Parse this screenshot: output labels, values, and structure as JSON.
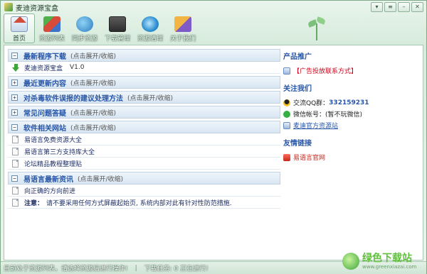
{
  "window": {
    "title": "麦迪资源宝盒"
  },
  "toolbar": {
    "items": [
      {
        "label": "首页",
        "icon": "home-icon"
      },
      {
        "label": "资源列表",
        "icon": "list-icon"
      },
      {
        "label": "同步资源",
        "icon": "sync-icon"
      },
      {
        "label": "下载管理",
        "icon": "download-icon"
      },
      {
        "label": "资源清理",
        "icon": "clean-icon"
      },
      {
        "label": "关于我们",
        "icon": "about-icon"
      }
    ]
  },
  "sections": [
    {
      "toggle": "−",
      "title": "最新程序下载",
      "hint": "(点击展开/收缩)",
      "rows": [
        {
          "text": "麦迪资源宝盒",
          "version": "V1.0"
        }
      ]
    },
    {
      "toggle": "+",
      "title": "最近更新内容",
      "hint": "(点击展开/收缩)"
    },
    {
      "toggle": "+",
      "title": "对杀毒软件误报的建议处理方法",
      "hint": "(点击展开/收缩)"
    },
    {
      "toggle": "+",
      "title": "常见问题答疑",
      "hint": "(点击展开/收缩)"
    },
    {
      "toggle": "−",
      "title": "软件相关网站",
      "hint": "(点击展开/收缩)",
      "rows": [
        {
          "text": "易语言免费资源大全"
        },
        {
          "text": "易语言第三方支持库大全"
        },
        {
          "text": "论坛精品教程整理贴"
        }
      ]
    },
    {
      "toggle": "−",
      "title": "易语言最新资讯",
      "hint": "(点击展开/收缩)",
      "rows": [
        {
          "text": "向正确的方向前进"
        }
      ],
      "note": {
        "label": "注意：",
        "text": "请不要采用任何方式屏蔽起始页, 系统内部对此有针对性防范措施."
      }
    }
  ],
  "right": {
    "promo": {
      "title": "产品推广",
      "ad": "【广告投放联系方式】"
    },
    "follow": {
      "title": "关注我们",
      "qq_label": "交流QQ群：",
      "qq_number": "332159231",
      "wechat": "微信帐号：(暂不玩微信)",
      "site": "麦迪官方资源站"
    },
    "links": {
      "title": "友情链接",
      "items": [
        "易语言官网"
      ]
    }
  },
  "status": {
    "left": "目前处于资源列表，请选择资源后进行操作!",
    "right": "下载任务: 0 正在进行!"
  },
  "watermark": {
    "main": "绿色下载站",
    "sub": "www.greenxiazai.com"
  }
}
